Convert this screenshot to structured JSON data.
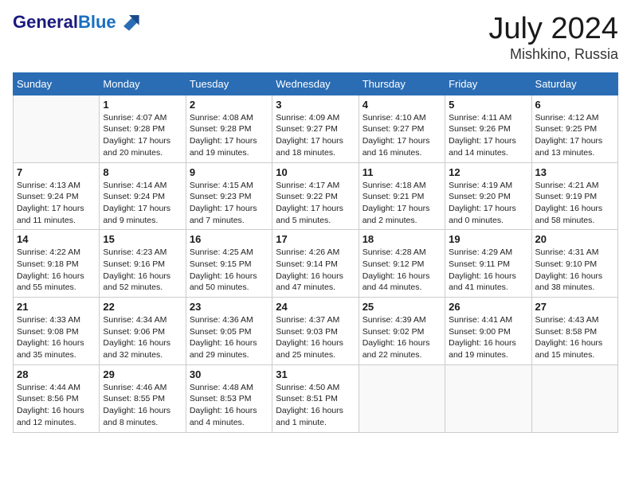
{
  "header": {
    "logo_line1": "General",
    "logo_line2": "Blue",
    "month_title": "July 2024",
    "location": "Mishkino, Russia"
  },
  "weekdays": [
    "Sunday",
    "Monday",
    "Tuesday",
    "Wednesday",
    "Thursday",
    "Friday",
    "Saturday"
  ],
  "weeks": [
    [
      {
        "num": "",
        "info": ""
      },
      {
        "num": "1",
        "info": "Sunrise: 4:07 AM\nSunset: 9:28 PM\nDaylight: 17 hours\nand 20 minutes."
      },
      {
        "num": "2",
        "info": "Sunrise: 4:08 AM\nSunset: 9:28 PM\nDaylight: 17 hours\nand 19 minutes."
      },
      {
        "num": "3",
        "info": "Sunrise: 4:09 AM\nSunset: 9:27 PM\nDaylight: 17 hours\nand 18 minutes."
      },
      {
        "num": "4",
        "info": "Sunrise: 4:10 AM\nSunset: 9:27 PM\nDaylight: 17 hours\nand 16 minutes."
      },
      {
        "num": "5",
        "info": "Sunrise: 4:11 AM\nSunset: 9:26 PM\nDaylight: 17 hours\nand 14 minutes."
      },
      {
        "num": "6",
        "info": "Sunrise: 4:12 AM\nSunset: 9:25 PM\nDaylight: 17 hours\nand 13 minutes."
      }
    ],
    [
      {
        "num": "7",
        "info": "Sunrise: 4:13 AM\nSunset: 9:24 PM\nDaylight: 17 hours\nand 11 minutes."
      },
      {
        "num": "8",
        "info": "Sunrise: 4:14 AM\nSunset: 9:24 PM\nDaylight: 17 hours\nand 9 minutes."
      },
      {
        "num": "9",
        "info": "Sunrise: 4:15 AM\nSunset: 9:23 PM\nDaylight: 17 hours\nand 7 minutes."
      },
      {
        "num": "10",
        "info": "Sunrise: 4:17 AM\nSunset: 9:22 PM\nDaylight: 17 hours\nand 5 minutes."
      },
      {
        "num": "11",
        "info": "Sunrise: 4:18 AM\nSunset: 9:21 PM\nDaylight: 17 hours\nand 2 minutes."
      },
      {
        "num": "12",
        "info": "Sunrise: 4:19 AM\nSunset: 9:20 PM\nDaylight: 17 hours\nand 0 minutes."
      },
      {
        "num": "13",
        "info": "Sunrise: 4:21 AM\nSunset: 9:19 PM\nDaylight: 16 hours\nand 58 minutes."
      }
    ],
    [
      {
        "num": "14",
        "info": "Sunrise: 4:22 AM\nSunset: 9:18 PM\nDaylight: 16 hours\nand 55 minutes."
      },
      {
        "num": "15",
        "info": "Sunrise: 4:23 AM\nSunset: 9:16 PM\nDaylight: 16 hours\nand 52 minutes."
      },
      {
        "num": "16",
        "info": "Sunrise: 4:25 AM\nSunset: 9:15 PM\nDaylight: 16 hours\nand 50 minutes."
      },
      {
        "num": "17",
        "info": "Sunrise: 4:26 AM\nSunset: 9:14 PM\nDaylight: 16 hours\nand 47 minutes."
      },
      {
        "num": "18",
        "info": "Sunrise: 4:28 AM\nSunset: 9:12 PM\nDaylight: 16 hours\nand 44 minutes."
      },
      {
        "num": "19",
        "info": "Sunrise: 4:29 AM\nSunset: 9:11 PM\nDaylight: 16 hours\nand 41 minutes."
      },
      {
        "num": "20",
        "info": "Sunrise: 4:31 AM\nSunset: 9:10 PM\nDaylight: 16 hours\nand 38 minutes."
      }
    ],
    [
      {
        "num": "21",
        "info": "Sunrise: 4:33 AM\nSunset: 9:08 PM\nDaylight: 16 hours\nand 35 minutes."
      },
      {
        "num": "22",
        "info": "Sunrise: 4:34 AM\nSunset: 9:06 PM\nDaylight: 16 hours\nand 32 minutes."
      },
      {
        "num": "23",
        "info": "Sunrise: 4:36 AM\nSunset: 9:05 PM\nDaylight: 16 hours\nand 29 minutes."
      },
      {
        "num": "24",
        "info": "Sunrise: 4:37 AM\nSunset: 9:03 PM\nDaylight: 16 hours\nand 25 minutes."
      },
      {
        "num": "25",
        "info": "Sunrise: 4:39 AM\nSunset: 9:02 PM\nDaylight: 16 hours\nand 22 minutes."
      },
      {
        "num": "26",
        "info": "Sunrise: 4:41 AM\nSunset: 9:00 PM\nDaylight: 16 hours\nand 19 minutes."
      },
      {
        "num": "27",
        "info": "Sunrise: 4:43 AM\nSunset: 8:58 PM\nDaylight: 16 hours\nand 15 minutes."
      }
    ],
    [
      {
        "num": "28",
        "info": "Sunrise: 4:44 AM\nSunset: 8:56 PM\nDaylight: 16 hours\nand 12 minutes."
      },
      {
        "num": "29",
        "info": "Sunrise: 4:46 AM\nSunset: 8:55 PM\nDaylight: 16 hours\nand 8 minutes."
      },
      {
        "num": "30",
        "info": "Sunrise: 4:48 AM\nSunset: 8:53 PM\nDaylight: 16 hours\nand 4 minutes."
      },
      {
        "num": "31",
        "info": "Sunrise: 4:50 AM\nSunset: 8:51 PM\nDaylight: 16 hours\nand 1 minute."
      },
      {
        "num": "",
        "info": ""
      },
      {
        "num": "",
        "info": ""
      },
      {
        "num": "",
        "info": ""
      }
    ]
  ]
}
